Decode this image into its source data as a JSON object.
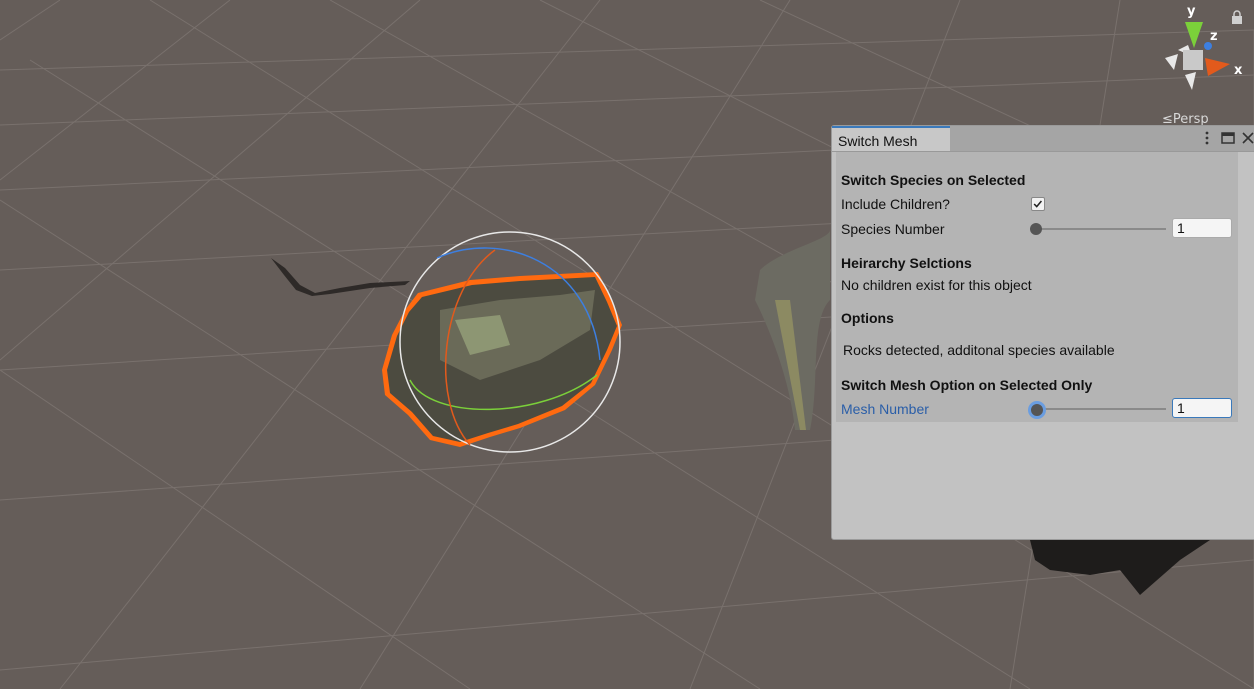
{
  "scene": {
    "gizmo_axes": {
      "y": "y",
      "z": "z",
      "x": "x"
    },
    "view_mode": "Persp",
    "colors": {
      "background": "#655d59",
      "grid": "#79716d",
      "selection_outline": "#ff6a10",
      "gizmo_y": "#7bd03a",
      "gizmo_x": "#e25a1c",
      "gizmo_z": "#3d7fe0"
    }
  },
  "window": {
    "tab_title": "Switch Mesh",
    "section_species": {
      "heading": "Switch Species on Selected",
      "include_children_label": "Include Children?",
      "include_children_checked": true,
      "species_number_label": "Species Number",
      "species_number_value": "1"
    },
    "section_hierarchy": {
      "heading": "Heirarchy Selctions",
      "message": "No children exist for this object"
    },
    "section_options": {
      "heading": "Options",
      "message": "Rocks detected, additonal species available"
    },
    "section_mesh": {
      "heading": "Switch Mesh Option on Selected Only",
      "mesh_number_label": "Mesh Number",
      "mesh_number_value": "1"
    }
  }
}
